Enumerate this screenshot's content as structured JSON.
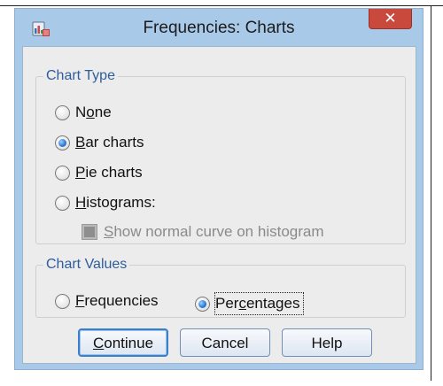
{
  "window": {
    "title": "Frequencies: Charts",
    "close_label": "✕",
    "icon": "spss-chart-app-icon"
  },
  "chart_type": {
    "legend": "Chart Type",
    "options": [
      {
        "pre": "N",
        "key": "o",
        "post": "ne",
        "checked": false
      },
      {
        "pre": "",
        "key": "B",
        "post": "ar charts",
        "checked": true
      },
      {
        "pre": "",
        "key": "P",
        "post": "ie charts",
        "checked": false
      },
      {
        "pre": "",
        "key": "H",
        "post": "istograms:",
        "checked": false
      }
    ],
    "normal_curve": {
      "pre": "",
      "key": "S",
      "post": "how normal curve on histogram",
      "enabled": false
    }
  },
  "chart_values": {
    "legend": "Chart Values",
    "options": [
      {
        "pre": "",
        "key": "F",
        "post": "requencies",
        "checked": false
      },
      {
        "pre": "Per",
        "key": "c",
        "post": "entages",
        "checked": true
      }
    ]
  },
  "buttons": {
    "continue": {
      "pre": "",
      "key": "C",
      "post": "ontinue"
    },
    "cancel": "Cancel",
    "help": "Help"
  },
  "colors": {
    "frame": "#a9c9e8",
    "close": "#c94a3c",
    "legend_text": "#2f5d9c",
    "client": "#ececec"
  }
}
